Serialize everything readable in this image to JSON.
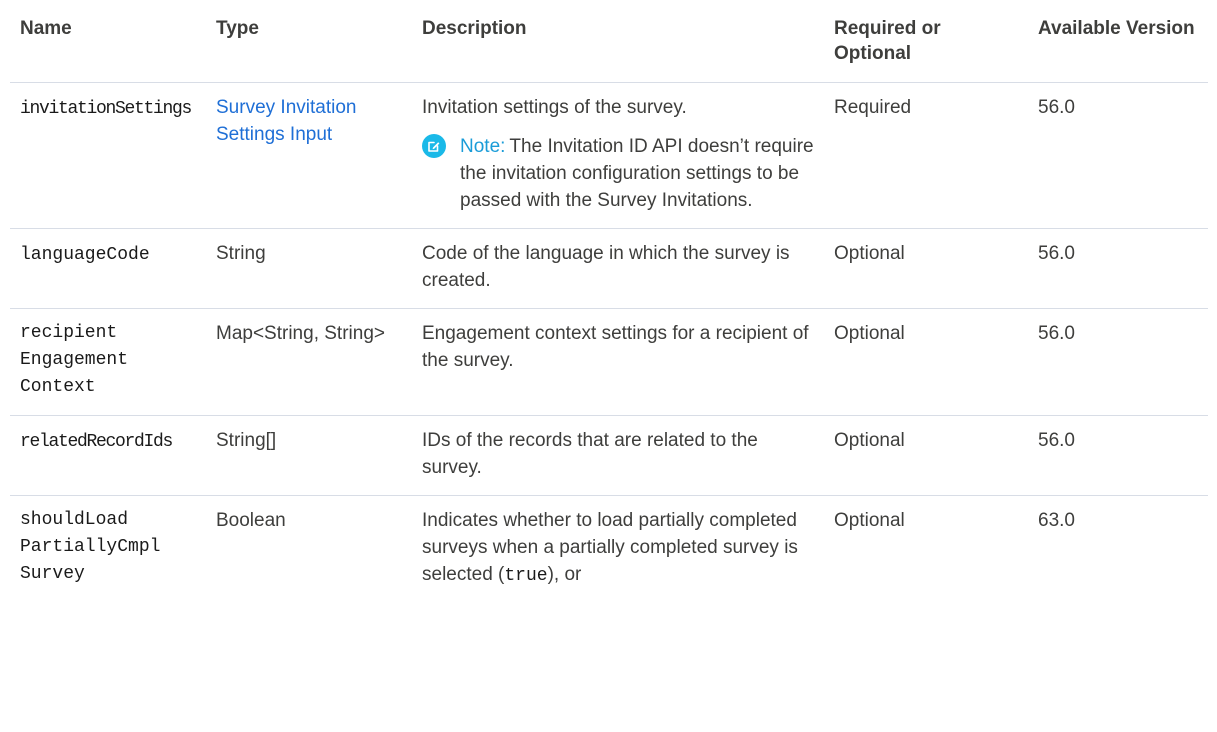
{
  "headers": {
    "name": "Name",
    "type": "Type",
    "description": "Description",
    "required": "Required or Optional",
    "version": "Available Version"
  },
  "rows": [
    {
      "name": "invitationSettings",
      "type": "Survey Invitation Settings Input",
      "description": "Invitation settings of the survey.",
      "note_label": "Note:",
      "note_text": "The Invitation ID API doesn’t require the invitation configuration settings to be passed with the Survey Invitations.",
      "required": "Required",
      "version": "56.0"
    },
    {
      "name": "languageCode",
      "type": "String",
      "description": "Code of the language in which the survey is created.",
      "required": "Optional",
      "version": "56.0"
    },
    {
      "name_lines": [
        "recipient",
        "Engagement",
        "Context"
      ],
      "type": "Map<String, String>",
      "description": "Engagement context settings for a recipient of the survey.",
      "required": "Optional",
      "version": "56.0"
    },
    {
      "name": "relatedRecordIds",
      "type": "String[]",
      "description": "IDs of the records that are related to the survey.",
      "required": "Optional",
      "version": "56.0"
    },
    {
      "name_lines": [
        "shouldLoad",
        "PartiallyCmpl",
        "Survey"
      ],
      "type": "Boolean",
      "description_before": "Indicates whether to load partially completed surveys when a partially completed survey is selected (",
      "description_code": "true",
      "description_after": "), or",
      "required": "Optional",
      "version": "63.0"
    }
  ],
  "icons": {
    "note": "note-edit-icon"
  },
  "colors": {
    "link": "#1f6fd6",
    "note_label": "#1a9cd8",
    "note_icon_bg": "#1ab9e8",
    "text": "#3e3e3c",
    "border": "#d8dde6"
  }
}
